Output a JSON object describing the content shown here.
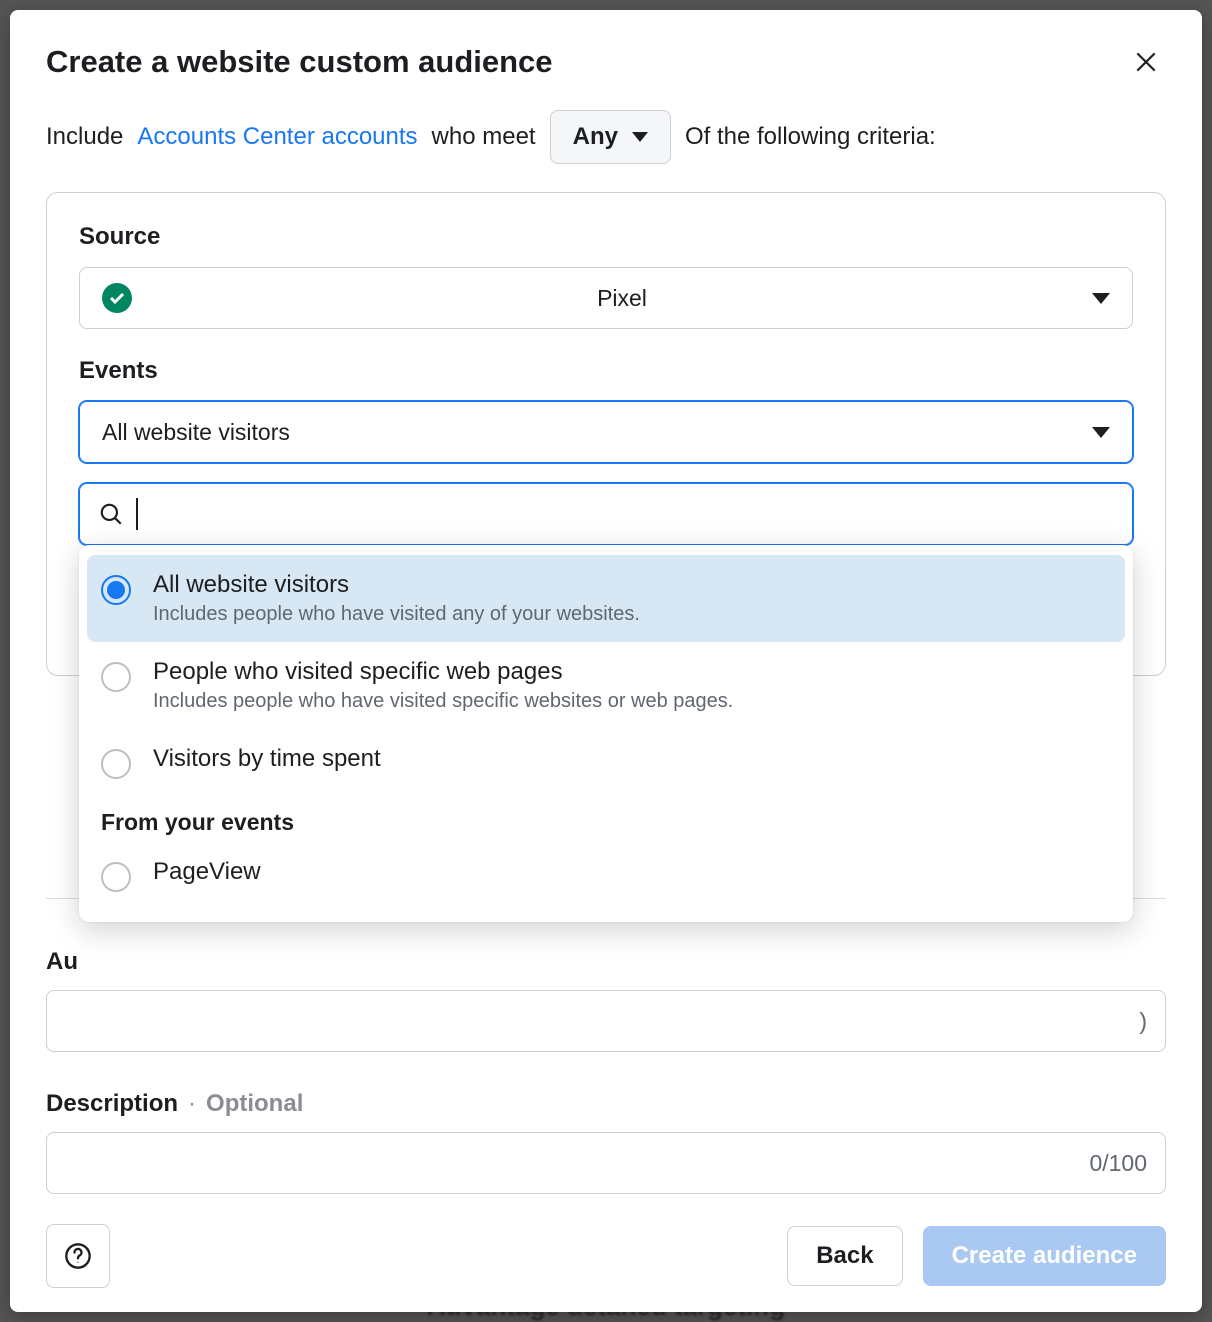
{
  "modal": {
    "title": "Create a website custom audience",
    "criteria": {
      "include_text": "Include",
      "link_text": "Accounts Center accounts",
      "who_meet": "who meet",
      "any_label": "Any",
      "of_following": "Of the following criteria:"
    }
  },
  "source": {
    "label": "Source",
    "selected": "Pixel"
  },
  "events": {
    "label": "Events",
    "selected": "All website visitors",
    "search_value": "",
    "options": [
      {
        "title": "All website visitors",
        "subtitle": "Includes people who have visited any of your websites.",
        "selected": true
      },
      {
        "title": "People who visited specific web pages",
        "subtitle": "Includes people who have visited specific websites or web pages.",
        "selected": false
      },
      {
        "title": "Visitors by time spent",
        "subtitle": "",
        "selected": false
      }
    ],
    "from_events_heading": "From your events",
    "custom_options": [
      {
        "title": "PageView",
        "selected": false
      }
    ]
  },
  "audience_label_partial": "Au",
  "hidden_input_char": ")",
  "description": {
    "label": "Description",
    "optional": "Optional",
    "counter": "0/100"
  },
  "footer": {
    "back": "Back",
    "create": "Create audience"
  },
  "background_peek": "Auvantage uetaneu targeting"
}
